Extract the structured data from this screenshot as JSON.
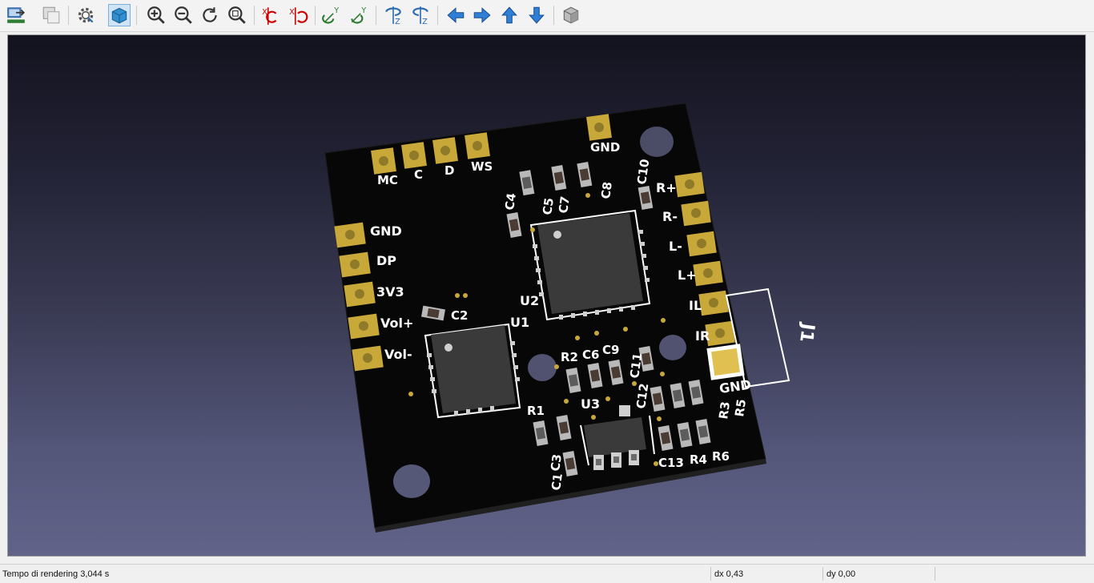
{
  "toolbar": {
    "items": [
      {
        "icon": "load-model-icon"
      },
      {
        "icon": "copy-view-icon"
      },
      {
        "icon": "settings-gear-icon"
      },
      {
        "icon": "board-3d-icon",
        "active": true
      },
      {
        "icon": "zoom-in-icon"
      },
      {
        "icon": "zoom-out-icon"
      },
      {
        "icon": "redraw-icon"
      },
      {
        "icon": "zoom-fit-icon"
      },
      {
        "icon": "rotate-x-cw-icon"
      },
      {
        "icon": "rotate-x-ccw-icon"
      },
      {
        "icon": "rotate-y-cw-icon"
      },
      {
        "icon": "rotate-y-ccw-icon"
      },
      {
        "icon": "rotate-z-cw-icon"
      },
      {
        "icon": "rotate-z-ccw-icon"
      },
      {
        "icon": "pan-left-icon"
      },
      {
        "icon": "pan-right-icon"
      },
      {
        "icon": "pan-up-icon"
      },
      {
        "icon": "pan-down-icon"
      },
      {
        "icon": "orthographic-cube-icon"
      }
    ]
  },
  "board": {
    "pins_top": [
      "MC",
      "C",
      "D",
      "WS"
    ],
    "pin_top_right": "GND",
    "pins_left": [
      "GND",
      "DP",
      "3V3",
      "Vol+",
      "Vol-"
    ],
    "pins_right": [
      "R+",
      "R-",
      "L-",
      "L+",
      "IL",
      "IR",
      "GND"
    ],
    "connector_ref": "J1",
    "ic_labels": [
      "U1",
      "U2",
      "U3"
    ],
    "component_labels": [
      "C1",
      "C2",
      "C3",
      "C4",
      "C5",
      "C6",
      "C7",
      "C8",
      "C9",
      "C10",
      "C11",
      "C12",
      "C13",
      "R1",
      "R2",
      "R3",
      "R4",
      "R5",
      "R6"
    ],
    "colors": {
      "soldermask": "#070707",
      "pad_gold": "#c9a83a",
      "silkscreen": "#ffffff",
      "ic_body": "#3a3a3a"
    }
  },
  "status": {
    "render_time": "Tempo di rendering 3,044 s",
    "dx": "dx 0,43",
    "dy": "dy 0,00"
  }
}
